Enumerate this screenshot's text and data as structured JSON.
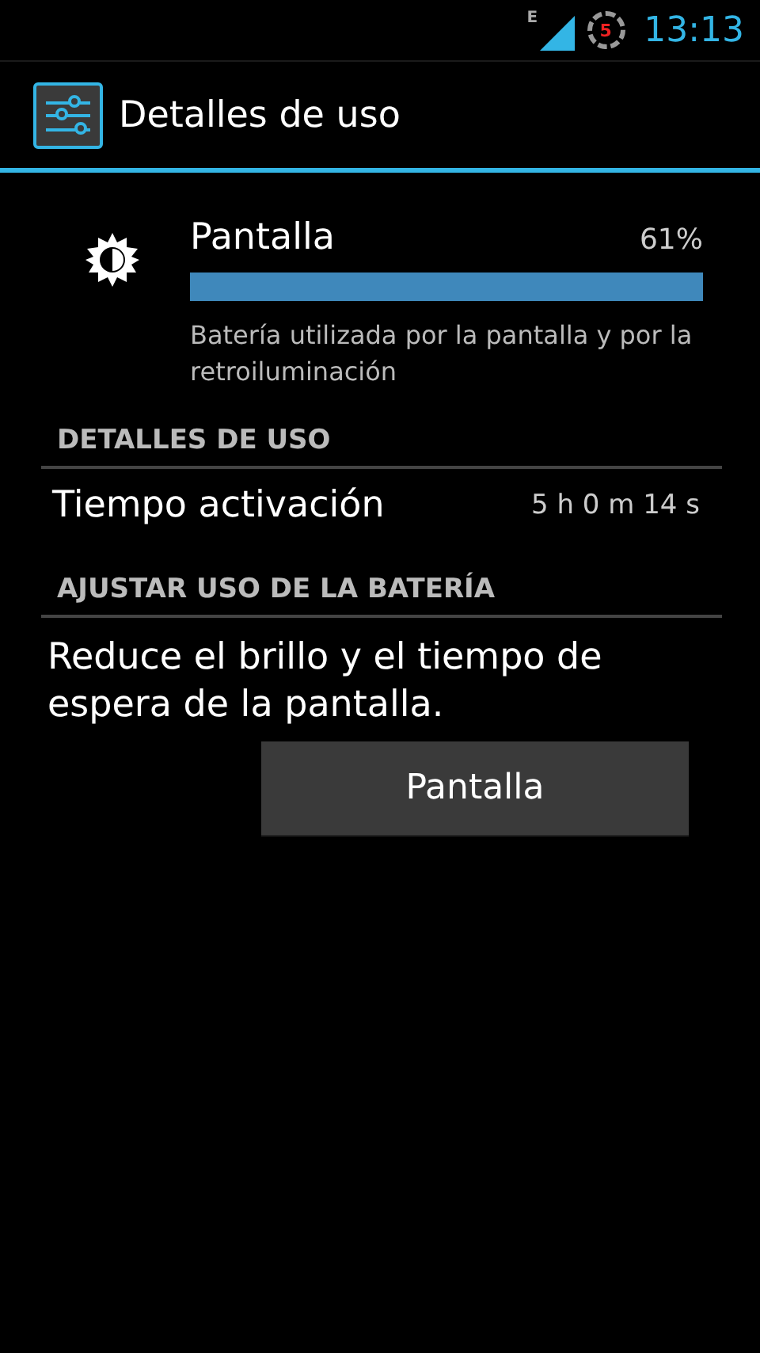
{
  "status_bar": {
    "network": "E",
    "notification_count": "5",
    "time": "13:13"
  },
  "action_bar": {
    "title": "Detalles de uso"
  },
  "usage": {
    "name": "Pantalla",
    "percent": "61%",
    "level": 1,
    "description": "Batería utilizada por la pantalla y por la retroiluminación"
  },
  "sections": [
    {
      "header": "DETALLES DE USO",
      "rows": [
        {
          "label": "Tiempo activación",
          "value": "5 h 0 m 14 s"
        }
      ]
    },
    {
      "header": "AJUSTAR USO DE LA BATERÍA",
      "text": "Reduce el brillo y el tiempo de espera de la pantalla.",
      "button": "Pantalla"
    }
  ]
}
